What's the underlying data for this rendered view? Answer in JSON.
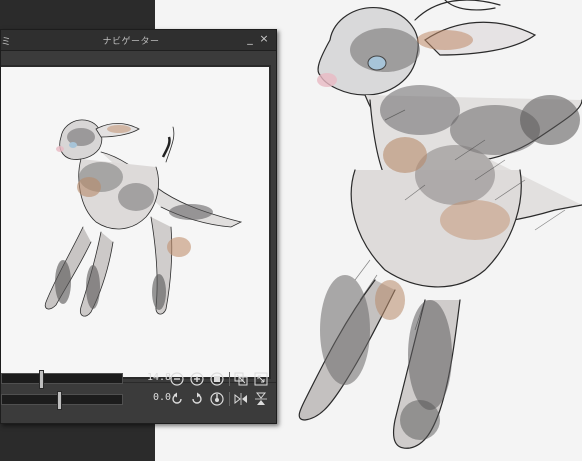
{
  "panel": {
    "title": "ナビゲーター",
    "title_left_fragment": "ミ",
    "minimize_glyph": "_",
    "close_glyph": "×"
  },
  "zoom": {
    "value": "14.8",
    "slider_fraction": 0.32
  },
  "rotation": {
    "value": "0.0",
    "slider_fraction": 0.47
  },
  "icons": {
    "zoom_out": "zoom-out-icon",
    "zoom_in": "zoom-in-icon",
    "fit": "fit-screen-icon",
    "actual_pixels": "actual-pixels-icon",
    "fit_window": "fit-window-icon",
    "rotate_left": "rotate-left-icon",
    "rotate_right": "rotate-right-icon",
    "rotate_reset": "rotate-reset-icon",
    "flip_horizontal": "flip-horizontal-icon",
    "flip_vertical": "flip-vertical-icon"
  },
  "colors": {
    "panel_bg": "#3b3b3b",
    "titlebar_bg": "#2f2f2f",
    "workspace_bg": "#2b2b2b",
    "canvas_bg": "#f4f4f4"
  }
}
